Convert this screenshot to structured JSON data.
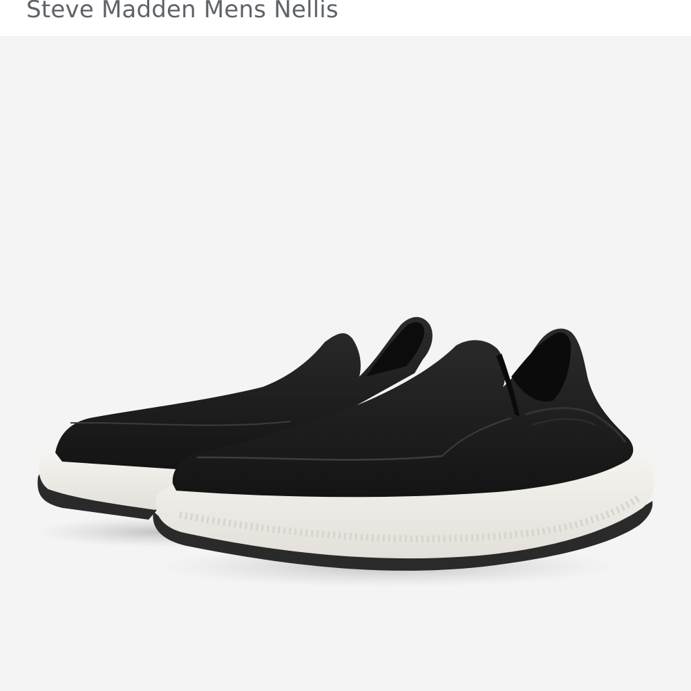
{
  "product": {
    "title": "Steve Madden Mens Nellis"
  },
  "image": {
    "alt": "Black slip-on shoes with white soles",
    "background_color": "#f4f4f4",
    "upper_color": "#1c1c1c",
    "sole_color": "#f2f0ec",
    "outsole_color": "#2a2a2a"
  }
}
